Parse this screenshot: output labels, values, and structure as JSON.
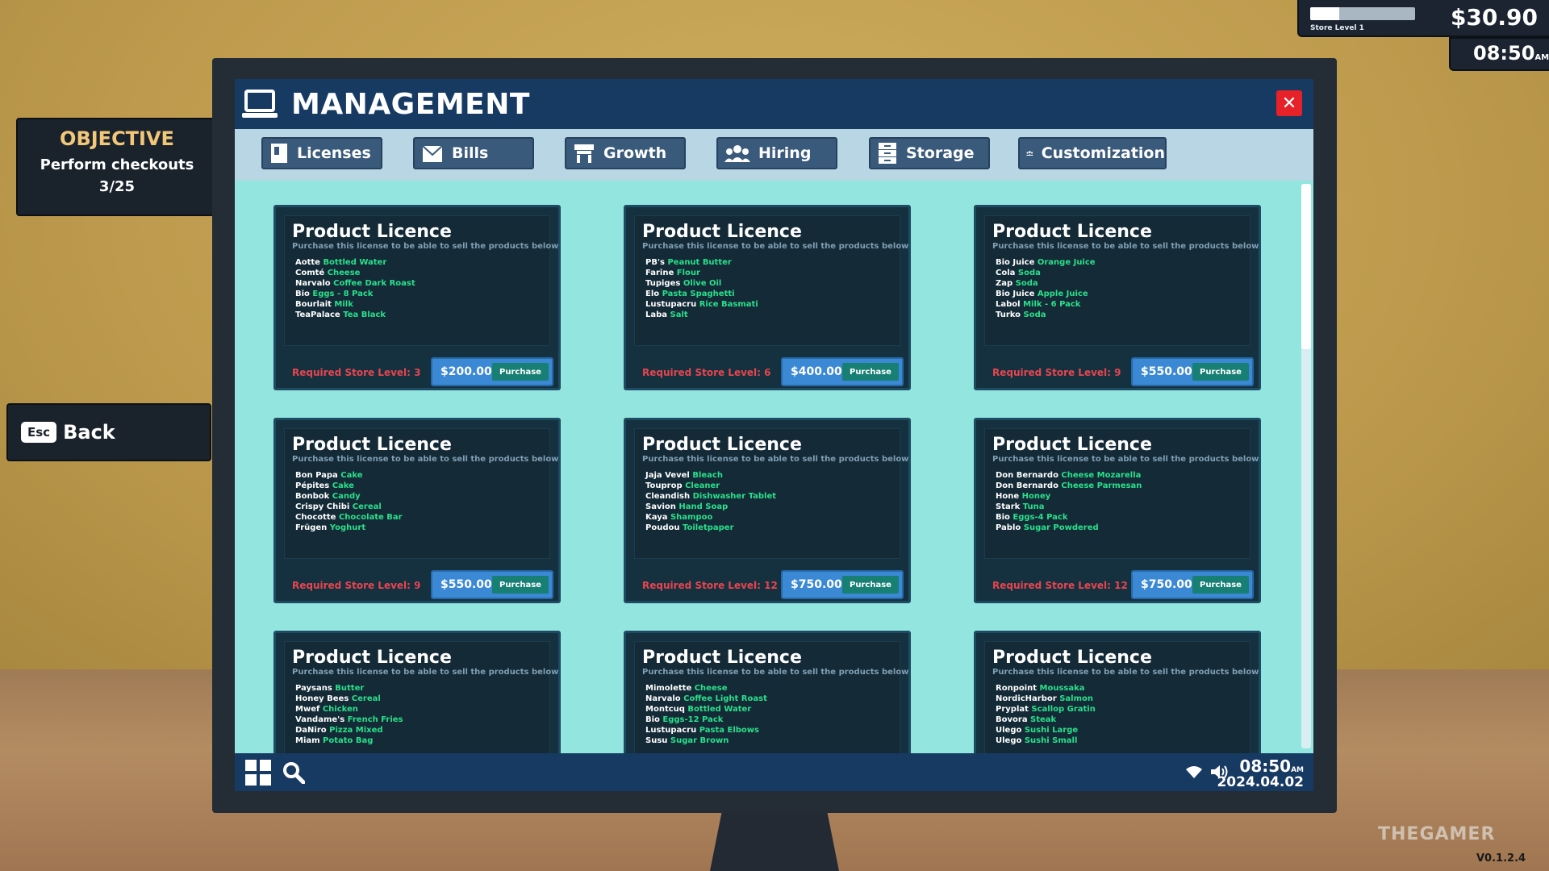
{
  "hud": {
    "store_level_label": "Store Level 1",
    "store_level_progress": 0.28,
    "money": "$30.90",
    "time": "08:50",
    "ampm": "AM"
  },
  "objective": {
    "title": "OBJECTIVE",
    "text": "Perform checkouts",
    "count": "3/25"
  },
  "back": {
    "key": "Esc",
    "label": "Back"
  },
  "window": {
    "title": "MANAGEMENT",
    "close_symbol": "✕"
  },
  "tabs": [
    {
      "label": "Licenses",
      "icon": "license-icon"
    },
    {
      "label": "Bills",
      "icon": "bills-icon"
    },
    {
      "label": "Growth",
      "icon": "growth-icon"
    },
    {
      "label": "Hiring",
      "icon": "hiring-icon"
    },
    {
      "label": "Storage",
      "icon": "storage-icon"
    },
    {
      "label": "Customization",
      "icon": "customization-icon"
    }
  ],
  "cards": [
    {
      "title": "Product Licence",
      "subtitle": "Purchase this license to be able to sell the products below",
      "items": [
        {
          "brand": "Aotte",
          "product": "Bottled Water"
        },
        {
          "brand": "Comté",
          "product": "Cheese"
        },
        {
          "brand": "Narvalo",
          "product": "Coffee Dark Roast"
        },
        {
          "brand": "Bio",
          "product": "Eggs - 8 Pack"
        },
        {
          "brand": "Bourlait",
          "product": "Milk"
        },
        {
          "brand": "TeaPalace",
          "product": "Tea Black"
        }
      ],
      "required": "Required Store Level: 3",
      "price": "$200.00",
      "button": "Purchase"
    },
    {
      "title": "Product Licence",
      "subtitle": "Purchase this license to be able to sell the products below",
      "items": [
        {
          "brand": "PB's",
          "product": "Peanut Butter"
        },
        {
          "brand": "Farine",
          "product": "Flour"
        },
        {
          "brand": "Tupiges",
          "product": "Olive Oil"
        },
        {
          "brand": "Elo",
          "product": "Pasta Spaghetti"
        },
        {
          "brand": "Lustupacru",
          "product": "Rice Basmati"
        },
        {
          "brand": "Laba",
          "product": "Salt"
        }
      ],
      "required": "Required Store Level: 6",
      "price": "$400.00",
      "button": "Purchase"
    },
    {
      "title": "Product Licence",
      "subtitle": "Purchase this license to be able to sell the products below",
      "items": [
        {
          "brand": "Bio Juice",
          "product": "Orange Juice"
        },
        {
          "brand": "Cola",
          "product": "Soda"
        },
        {
          "brand": "Zap",
          "product": "Soda"
        },
        {
          "brand": "Bio Juice",
          "product": "Apple Juice"
        },
        {
          "brand": "Labol",
          "product": "Milk - 6 Pack"
        },
        {
          "brand": "Turko",
          "product": "Soda"
        }
      ],
      "required": "Required Store Level: 9",
      "price": "$550.00",
      "button": "Purchase"
    },
    {
      "title": "Product Licence",
      "subtitle": "Purchase this license to be able to sell the products below",
      "items": [
        {
          "brand": "Bon Papa",
          "product": "Cake"
        },
        {
          "brand": "Pépites",
          "product": "Cake"
        },
        {
          "brand": "Bonbok",
          "product": "Candy"
        },
        {
          "brand": "Crispy Chibi",
          "product": "Cereal"
        },
        {
          "brand": "Chocotte",
          "product": "Chocolate Bar"
        },
        {
          "brand": "Frügen",
          "product": "Yoghurt"
        }
      ],
      "required": "Required Store Level: 9",
      "price": "$550.00",
      "button": "Purchase"
    },
    {
      "title": "Product Licence",
      "subtitle": "Purchase this license to be able to sell the products below",
      "items": [
        {
          "brand": "Jaja Vevel",
          "product": "Bleach"
        },
        {
          "brand": "Touprop",
          "product": "Cleaner"
        },
        {
          "brand": "Cleandish",
          "product": "Dishwasher Tablet"
        },
        {
          "brand": "Savion",
          "product": "Hand Soap"
        },
        {
          "brand": "Kaya",
          "product": "Shampoo"
        },
        {
          "brand": "Poudou",
          "product": "Toiletpaper"
        }
      ],
      "required": "Required Store Level: 12",
      "price": "$750.00",
      "button": "Purchase"
    },
    {
      "title": "Product Licence",
      "subtitle": "Purchase this license to be able to sell the products below",
      "items": [
        {
          "brand": "Don Bernardo",
          "product": "Cheese Mozarella"
        },
        {
          "brand": "Don Bernardo",
          "product": "Cheese Parmesan"
        },
        {
          "brand": "Hone",
          "product": "Honey"
        },
        {
          "brand": "Stark",
          "product": "Tuna"
        },
        {
          "brand": "Bio",
          "product": "Eggs-4 Pack"
        },
        {
          "brand": "Pablo",
          "product": "Sugar Powdered"
        }
      ],
      "required": "Required Store Level: 12",
      "price": "$750.00",
      "button": "Purchase"
    },
    {
      "title": "Product Licence",
      "subtitle": "Purchase this license to be able to sell the products below",
      "items": [
        {
          "brand": "Paysans",
          "product": "Butter"
        },
        {
          "brand": "Honey Bees",
          "product": "Cereal"
        },
        {
          "brand": "Mwef",
          "product": "Chicken"
        },
        {
          "brand": "Vandame's",
          "product": "French Fries"
        },
        {
          "brand": "DaNiro",
          "product": "Pizza Mixed"
        },
        {
          "brand": "Miam",
          "product": "Potato Bag"
        }
      ],
      "required": "",
      "price": "",
      "button": ""
    },
    {
      "title": "Product Licence",
      "subtitle": "Purchase this license to be able to sell the products below",
      "items": [
        {
          "brand": "Mimolette",
          "product": "Cheese"
        },
        {
          "brand": "Narvalo",
          "product": "Coffee Light Roast"
        },
        {
          "brand": "Montcuq",
          "product": "Bottled Water"
        },
        {
          "brand": "Bio",
          "product": "Eggs-12 Pack"
        },
        {
          "brand": "Lustupacru",
          "product": "Pasta Elbows"
        },
        {
          "brand": "Susu",
          "product": "Sugar Brown"
        }
      ],
      "required": "",
      "price": "",
      "button": ""
    },
    {
      "title": "Product Licence",
      "subtitle": "Purchase this license to be able to sell the products below",
      "items": [
        {
          "brand": "Ronpoint",
          "product": "Moussaka"
        },
        {
          "brand": "NordicHarbor",
          "product": "Salmon"
        },
        {
          "brand": "Pryplat",
          "product": "Scallop Gratin"
        },
        {
          "brand": "Bovora",
          "product": "Steak"
        },
        {
          "brand": "Ulego",
          "product": "Sushi Large"
        },
        {
          "brand": "Ulego",
          "product": "Sushi Small"
        }
      ],
      "required": "",
      "price": "",
      "button": ""
    }
  ],
  "taskbar": {
    "time": "08:50",
    "ampm": "AM",
    "date": "2024.04.02"
  },
  "watermark": "THEGAMER",
  "version": "V0.1.2.4",
  "colors": {
    "screen_bg": "#93e6e0",
    "titlebar": "#173a63",
    "card_bg": "#15303f",
    "product_green": "#29e08a",
    "required_red": "#e8454e",
    "price_blue": "#3b89d4",
    "buy_teal": "#177f74",
    "close_red": "#e62128",
    "objective_gold": "#f3c77a"
  }
}
